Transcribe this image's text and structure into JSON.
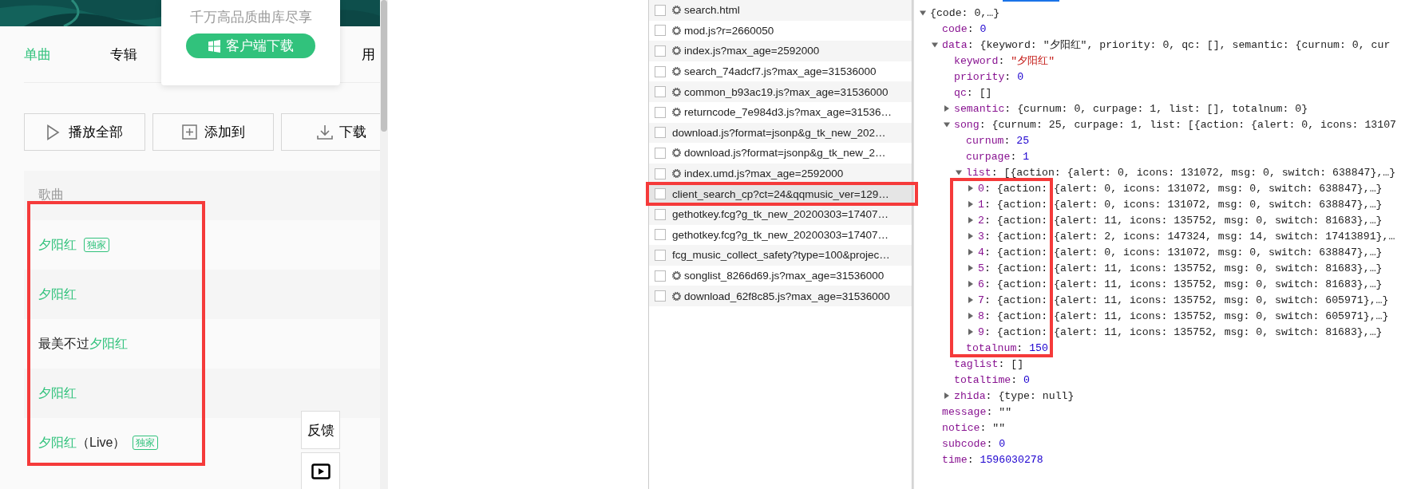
{
  "music_page": {
    "promo": {
      "slogan": "千万高品质曲库尽享",
      "download_button": "客户端下载"
    },
    "tabs": [
      {
        "label": "单曲",
        "selected": true
      },
      {
        "label": "专辑",
        "selected": false
      },
      {
        "label": "用",
        "selected": false
      }
    ],
    "actions": [
      {
        "label": "播放全部",
        "kind": "play"
      },
      {
        "label": "添加到",
        "kind": "add"
      },
      {
        "label": "下载",
        "kind": "download"
      }
    ],
    "song_list": {
      "header": "歌曲",
      "rows": [
        {
          "title": [
            {
              "text": "夕阳红",
              "match": true
            }
          ],
          "badge": "独家"
        },
        {
          "title": [
            {
              "text": "夕阳红",
              "match": true
            }
          ]
        },
        {
          "title": [
            {
              "text": "最美不过",
              "match": false
            },
            {
              "text": "夕阳红",
              "match": true
            }
          ]
        },
        {
          "title": [
            {
              "text": "夕阳红",
              "match": true
            }
          ]
        },
        {
          "title": [
            {
              "text": "夕阳红",
              "match": true
            },
            {
              "text": "（Live）",
              "match": false
            }
          ],
          "badge": "独家"
        }
      ]
    },
    "feedback": "反馈"
  },
  "network_requests": [
    {
      "name": "search.html",
      "gear": true,
      "checked": false,
      "selected": false
    },
    {
      "name": "mod.js?r=2660050",
      "gear": true,
      "checked": false,
      "selected": false
    },
    {
      "name": "index.js?max_age=2592000",
      "gear": true,
      "checked": false,
      "selected": false
    },
    {
      "name": "search_74adcf7.js?max_age=31536000",
      "gear": true,
      "checked": false,
      "selected": false
    },
    {
      "name": "common_b93ac19.js?max_age=31536000",
      "gear": true,
      "checked": false,
      "selected": false
    },
    {
      "name": "returncode_7e984d3.js?max_age=31536…",
      "gear": true,
      "checked": false,
      "selected": false
    },
    {
      "name": "download.js?format=jsonp&g_tk_new_202…",
      "gear": false,
      "checked": false,
      "selected": false
    },
    {
      "name": "download.js?format=jsonp&g_tk_new_2…",
      "gear": true,
      "checked": false,
      "selected": false
    },
    {
      "name": "index.umd.js?max_age=2592000",
      "gear": true,
      "checked": false,
      "selected": false
    },
    {
      "name": "client_search_cp?ct=24&qqmusic_ver=129…",
      "gear": false,
      "checked": false,
      "selected": true
    },
    {
      "name": "gethotkey.fcg?g_tk_new_20200303=17407…",
      "gear": false,
      "checked": false,
      "selected": false
    },
    {
      "name": "gethotkey.fcg?g_tk_new_20200303=17407…",
      "gear": false,
      "checked": false,
      "selected": false
    },
    {
      "name": "fcg_music_collect_safety?type=100&projec…",
      "gear": false,
      "checked": false,
      "selected": false
    },
    {
      "name": "songlist_8266d69.js?max_age=31536000",
      "gear": true,
      "checked": false,
      "selected": false
    },
    {
      "name": "download_62f8c85.js?max_age=31536000",
      "gear": true,
      "checked": false,
      "selected": false
    }
  ],
  "response_preview": {
    "summary": "{code: 0,…}",
    "expanded": true,
    "children": [
      {
        "key": "code:",
        "value": "0",
        "kind": "number"
      },
      {
        "key": "data:",
        "summary": "{keyword: \"夕阳红\", priority: 0, qc: [], semantic: {curnum: 0, cur",
        "expanded": true,
        "children": [
          {
            "key": "keyword:",
            "value": "\"夕阳红\"",
            "kind": "string"
          },
          {
            "key": "priority:",
            "value": "0",
            "kind": "number"
          },
          {
            "key": "qc:",
            "value": "[]",
            "kind": "plain"
          },
          {
            "key": "semantic:",
            "summary": "{curnum: 0, curpage: 1, list: [], totalnum: 0}",
            "expanded": false
          },
          {
            "key": "song:",
            "summary": "{curnum: 25, curpage: 1, list: [{action: {alert: 0, icons: 13107",
            "expanded": true,
            "children": [
              {
                "key": "curnum:",
                "value": "25",
                "kind": "number"
              },
              {
                "key": "curpage:",
                "value": "1",
                "kind": "number"
              },
              {
                "key": "list:",
                "summary": "[{action: {alert: 0, icons: 131072, msg: 0, switch: 638847},…}",
                "expanded": true,
                "children": [
                  {
                    "key": "0:",
                    "summary": "{action: {alert: 0, icons: 131072, msg: 0, switch: 638847},…}",
                    "expanded": false
                  },
                  {
                    "key": "1:",
                    "summary": "{action: {alert: 0, icons: 131072, msg: 0, switch: 638847},…}",
                    "expanded": false
                  },
                  {
                    "key": "2:",
                    "summary": "{action: {alert: 11, icons: 135752, msg: 0, switch: 81683},…}",
                    "expanded": false
                  },
                  {
                    "key": "3:",
                    "summary": "{action: {alert: 2, icons: 147324, msg: 14, switch: 17413891},…",
                    "expanded": false
                  },
                  {
                    "key": "4:",
                    "summary": "{action: {alert: 0, icons: 131072, msg: 0, switch: 638847},…}",
                    "expanded": false
                  },
                  {
                    "key": "5:",
                    "summary": "{action: {alert: 11, icons: 135752, msg: 0, switch: 81683},…}",
                    "expanded": false
                  },
                  {
                    "key": "6:",
                    "summary": "{action: {alert: 11, icons: 135752, msg: 0, switch: 81683},…}",
                    "expanded": false
                  },
                  {
                    "key": "7:",
                    "summary": "{action: {alert: 11, icons: 135752, msg: 0, switch: 605971},…}",
                    "expanded": false
                  },
                  {
                    "key": "8:",
                    "summary": "{action: {alert: 11, icons: 135752, msg: 0, switch: 605971},…}",
                    "expanded": false
                  },
                  {
                    "key": "9:",
                    "summary": "{action: {alert: 11, icons: 135752, msg: 0, switch: 81683},…}",
                    "expanded": false
                  }
                ]
              },
              {
                "key": "totalnum:",
                "value": "150",
                "kind": "number"
              }
            ]
          },
          {
            "key": "taglist:",
            "value": "[]",
            "kind": "plain"
          },
          {
            "key": "totaltime:",
            "value": "0",
            "kind": "number"
          },
          {
            "key": "zhida:",
            "summary": "{type: null}",
            "expanded": false
          }
        ]
      },
      {
        "key": "message:",
        "value": "\"\"",
        "kind": "plain"
      },
      {
        "key": "notice:",
        "value": "\"\"",
        "kind": "plain"
      },
      {
        "key": "subcode:",
        "value": "0",
        "kind": "number"
      },
      {
        "key": "time:",
        "value": "1596030278",
        "kind": "number"
      }
    ]
  }
}
